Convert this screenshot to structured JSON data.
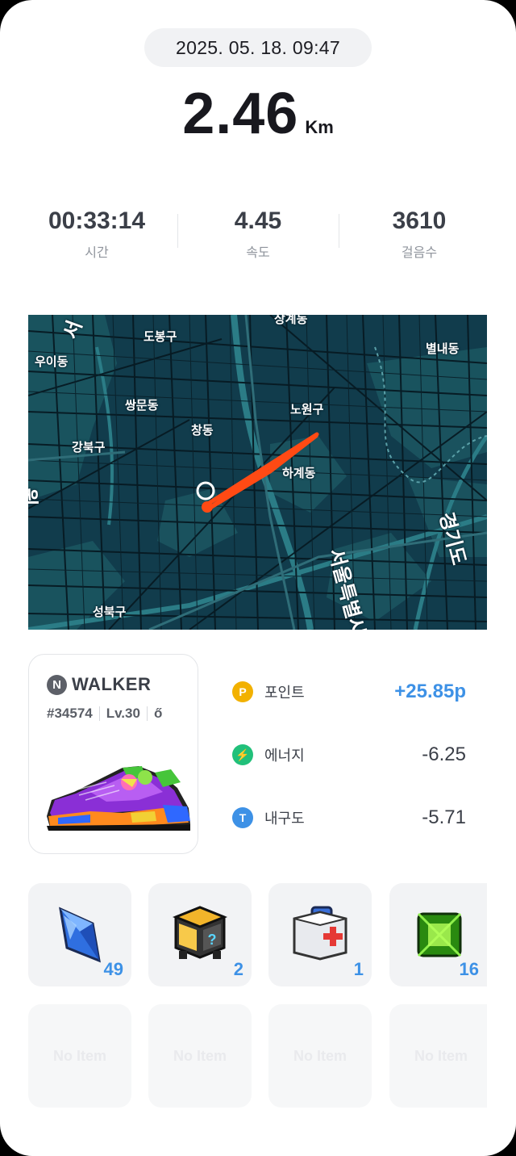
{
  "header": {
    "datetime": "2025. 05. 18. 09:47",
    "distance": "2.46",
    "distance_unit": "Km"
  },
  "stats": [
    {
      "value": "00:33:14",
      "label": "시간"
    },
    {
      "value": "4.45",
      "label": "속도"
    },
    {
      "value": "3610",
      "label": "걸음수"
    }
  ],
  "map": {
    "labels": [
      "상계동",
      "도봉구",
      "별내동",
      "우이동",
      "쌍문동",
      "노원구",
      "창동",
      "강북구",
      "하계동",
      "원",
      "서울특별시",
      "경기도",
      "성북구",
      "서"
    ],
    "route_color": "#ff4a14"
  },
  "shoe": {
    "brand_letter": "N",
    "brand_name": "WALKER",
    "id": "#34574",
    "level": "Lv.30",
    "extra": "ő"
  },
  "rewards": [
    {
      "icon": "point-icon",
      "icon_glyph": "P",
      "label": "포인트",
      "value": "+25.85p",
      "color": "#f2b100"
    },
    {
      "icon": "energy-icon",
      "icon_glyph": "⚡",
      "label": "에너지",
      "value": "-6.25",
      "color": "#21c07a"
    },
    {
      "icon": "durability-icon",
      "icon_glyph": "T",
      "label": "내구도",
      "value": "-5.71",
      "color": "#3d91e6"
    }
  ],
  "inventory": [
    {
      "icon": "blue-crystal-icon",
      "count": "49"
    },
    {
      "icon": "mystery-box-icon",
      "count": "2"
    },
    {
      "icon": "first-aid-kit-icon",
      "count": "1"
    },
    {
      "icon": "green-gem-icon",
      "count": "16"
    }
  ],
  "empty_slots": [
    "No Item",
    "No Item",
    "No Item",
    "No Item"
  ]
}
